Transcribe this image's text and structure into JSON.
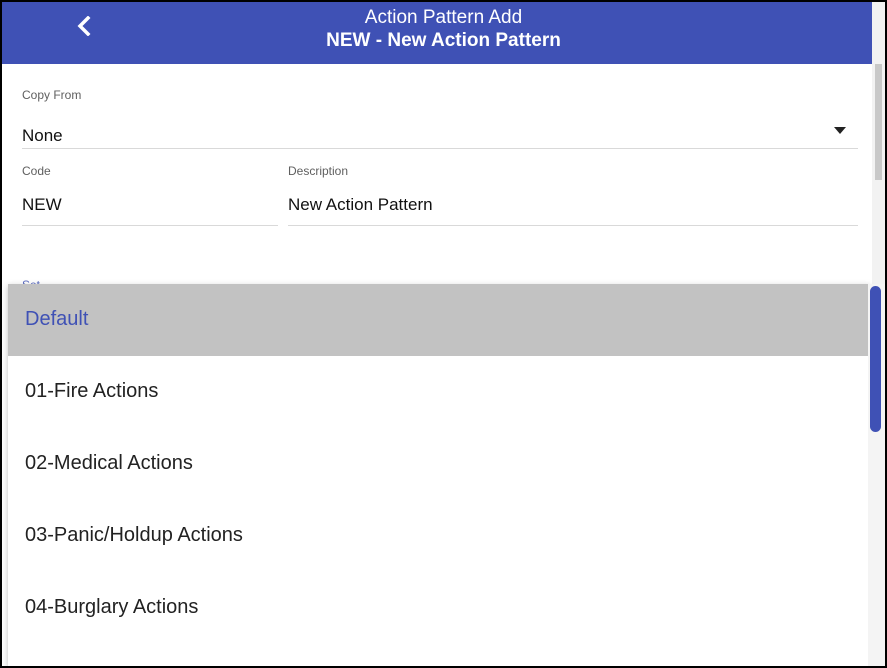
{
  "header": {
    "title": "Action Pattern Add",
    "subtitle": "NEW - New Action Pattern",
    "back_icon": "chevron-left-icon",
    "color": "#3f51b5"
  },
  "form": {
    "copy_from": {
      "label": "Copy From",
      "value": "None"
    },
    "code": {
      "label": "Code",
      "value": "NEW"
    },
    "description": {
      "label": "Description",
      "value": "New Action Pattern"
    }
  },
  "dropdown": {
    "options": [
      {
        "label": "Default",
        "selected": true
      },
      {
        "label": "01-Fire Actions",
        "selected": false
      },
      {
        "label": "02-Medical Actions",
        "selected": false
      },
      {
        "label": "03-Panic/Holdup Actions",
        "selected": false
      },
      {
        "label": "04-Burglary Actions",
        "selected": false
      }
    ],
    "selected_color": "#3f51b5"
  }
}
